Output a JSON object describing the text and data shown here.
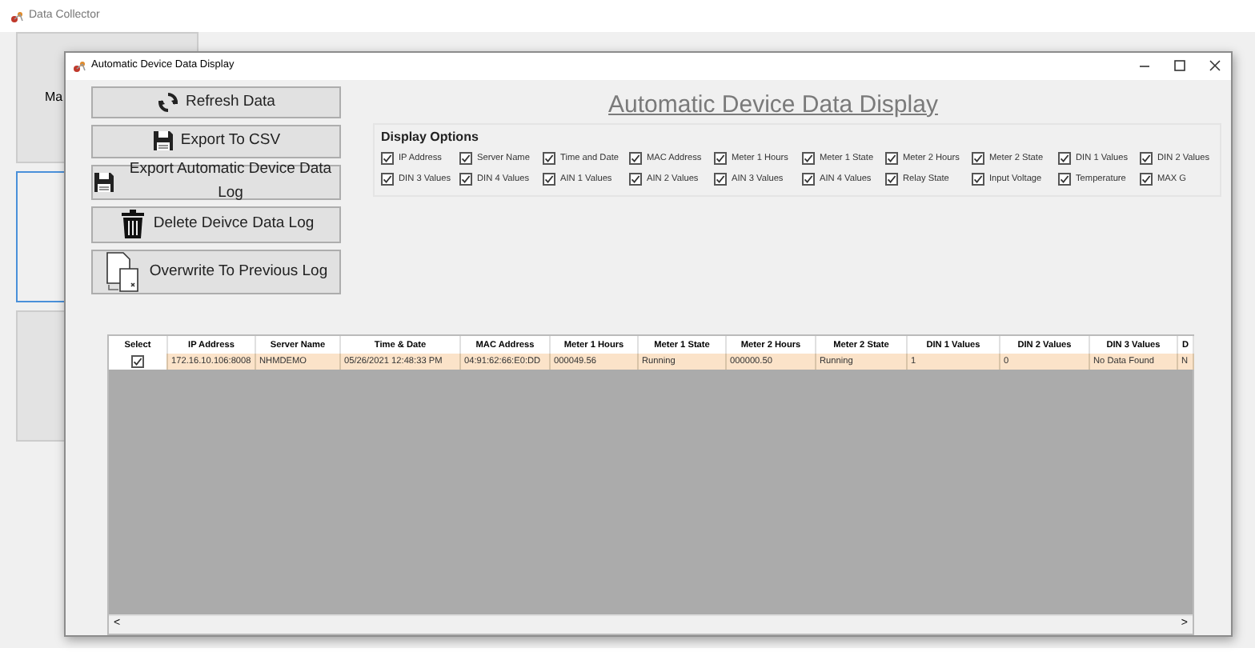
{
  "background_window": {
    "title": "Data Collector",
    "panels": [
      {
        "label": "Ma",
        "focused": false
      },
      {
        "focused": true
      },
      {
        "focused": false
      }
    ]
  },
  "dialog": {
    "title": "Automatic Device Data Display",
    "actions": [
      {
        "label": "Refresh Data",
        "kind": "refresh"
      },
      {
        "label": "Export To CSV",
        "kind": "save"
      },
      {
        "label": "Export Automatic Device Data Log",
        "kind": "save"
      },
      {
        "label": "Delete Deivce Data Log",
        "kind": "trash"
      },
      {
        "label": "Overwrite To Previous Log",
        "kind": "documents"
      }
    ],
    "heading": "Automatic Device Data Display",
    "display_options": {
      "title": "Display Options",
      "options": [
        {
          "label": "IP Address",
          "checked": true
        },
        {
          "label": "Server Name",
          "checked": true
        },
        {
          "label": "Time and Date",
          "checked": true
        },
        {
          "label": "MAC Address",
          "checked": true
        },
        {
          "label": "Meter 1 Hours",
          "checked": true
        },
        {
          "label": "Meter 1 State",
          "checked": true
        },
        {
          "label": "Meter 2 Hours",
          "checked": true
        },
        {
          "label": "Meter 2 State",
          "checked": true
        },
        {
          "label": "DIN 1 Values",
          "checked": true
        },
        {
          "label": "DIN 2 Values",
          "checked": true
        },
        {
          "label": "DIN 3 Values",
          "checked": true
        },
        {
          "label": "DIN 4 Values",
          "checked": true
        },
        {
          "label": "AIN 1 Values",
          "checked": true
        },
        {
          "label": "AIN 2 Values",
          "checked": true
        },
        {
          "label": "AIN 3 Values",
          "checked": true
        },
        {
          "label": "AIN 4 Values",
          "checked": true
        },
        {
          "label": "Relay State",
          "checked": true
        },
        {
          "label": "Input Voltage",
          "checked": true
        },
        {
          "label": "Temperature",
          "checked": true
        },
        {
          "label": "MAX G",
          "checked": true
        }
      ]
    },
    "table": {
      "select_header": "Select",
      "columns": [
        "IP Address",
        "Server Name",
        "Time & Date",
        "MAC Address",
        "Meter 1 Hours",
        "Meter 1 State",
        "Meter 2 Hours",
        "Meter 2 State",
        "DIN 1 Values",
        "DIN 2 Values",
        "DIN 3 Values",
        "D"
      ],
      "rows": [
        {
          "checked": true,
          "cells": [
            "172.16.10.106:8008",
            "NHMDEMO",
            "05/26/2021 12:48:33 PM",
            "04:91:62:66:E0:DD",
            "000049.56",
            "Running",
            "000000.50",
            "Running",
            "1",
            "0",
            "No Data Found",
            "N"
          ]
        }
      ]
    },
    "scrollbar": {
      "left": "<",
      "right": ">"
    }
  }
}
